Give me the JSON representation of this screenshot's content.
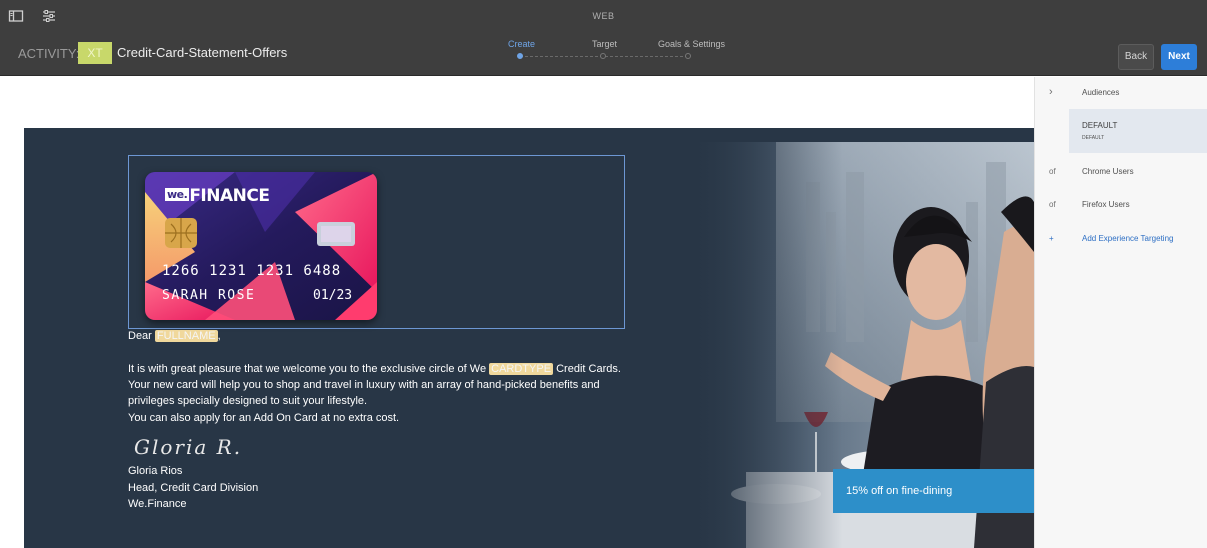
{
  "header": {
    "mode_label": "WEB",
    "activity_prefix": "ACTIVITY:",
    "activity_type": "XT",
    "activity_name": "Credit-Card-Statement-Offers",
    "steps": [
      {
        "label": "Create",
        "active": true
      },
      {
        "label": "Target",
        "active": false
      },
      {
        "label": "Goals & Settings",
        "active": false
      }
    ],
    "back_label": "Back",
    "next_label": "Next",
    "icons": [
      "panel-toggle-icon",
      "settings-sliders-icon"
    ]
  },
  "email": {
    "card": {
      "brand_we": "we.",
      "brand_finance": "FINANCE",
      "number": "1266 1231 1231 6488",
      "holder": "SARAH ROSE",
      "expiry": "01/23"
    },
    "greeting_prefix": "Dear ",
    "fullname_token": "FULLNAME",
    "greeting_suffix": ",",
    "para1_prefix": "It is with great pleasure that we welcome you to the exclusive circle of We ",
    "cardtype_token": "CARDTYPE",
    "para1_suffix": " Credit Cards.",
    "para2": "Your new card will help you to shop and travel in luxury with an array of hand-picked benefits and",
    "para3": "privileges specially designed to suit your lifestyle.",
    "para4": "You can also apply for an Add On Card at no extra cost.",
    "signature_script": "Gloria R.",
    "sign_name": "Gloria Rios",
    "sign_title": "Head, Credit Card Division",
    "sign_company": "We.Finance",
    "offer_text": "15% off on fine-dining"
  },
  "panel": {
    "audiences_label": "Audiences",
    "selected_title": "DEFAULT",
    "selected_sub": "DEFAULT",
    "rows": [
      {
        "lead": "of",
        "label": "Chrome Users"
      },
      {
        "lead": "of",
        "label": "Firefox Users"
      }
    ],
    "add_lead": "+",
    "add_label": "Add Experience Targeting"
  },
  "colors": {
    "topbar": "#3e3e3e",
    "accent_blue": "#2d7ed9",
    "email_bg": "#283646",
    "token_highlight": "#f0d89c",
    "xt_badge": "#c8d86a"
  }
}
